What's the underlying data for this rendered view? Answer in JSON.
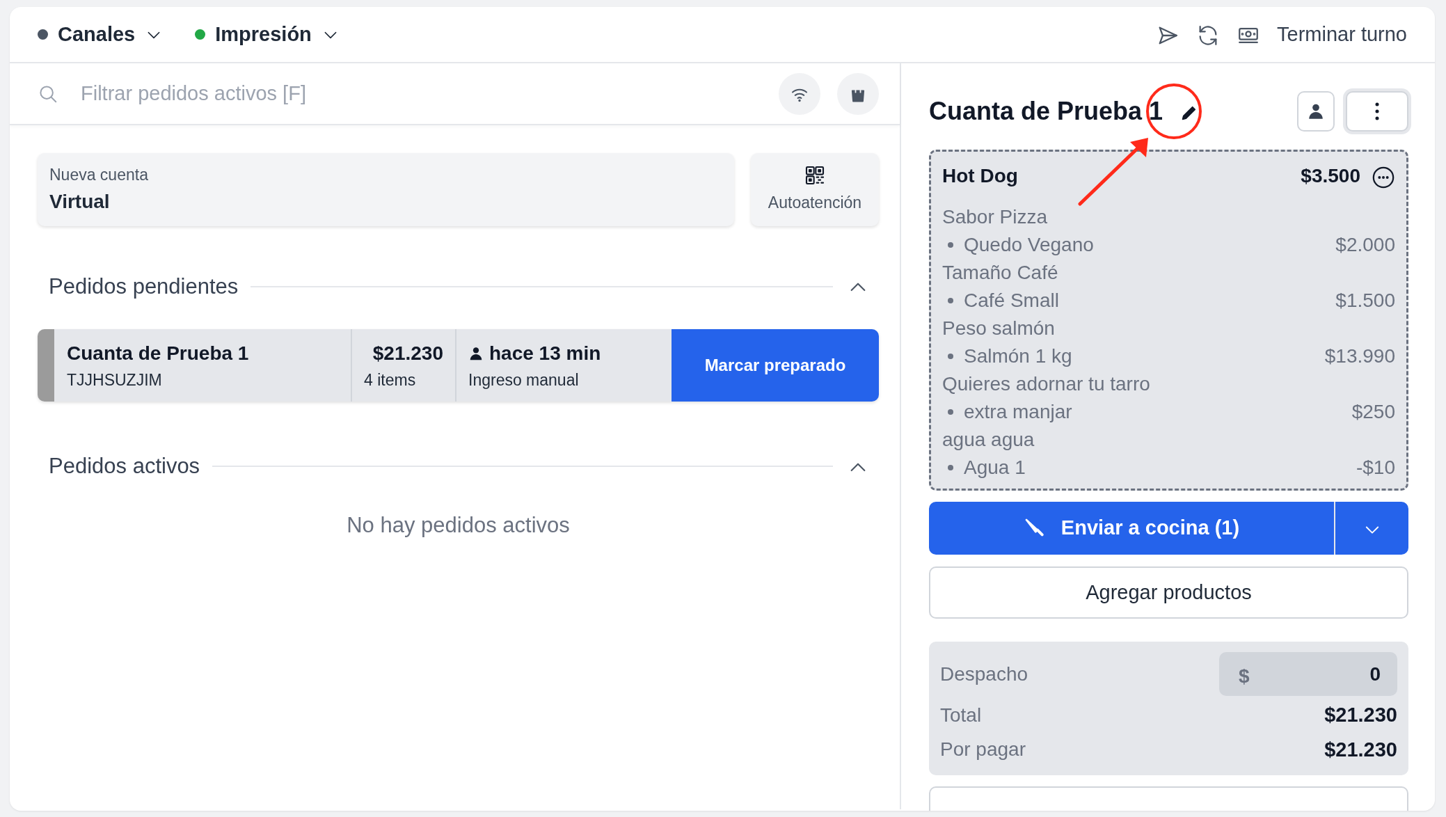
{
  "header": {
    "menus": [
      {
        "label": "Canales",
        "color": "#4b5563"
      },
      {
        "label": "Impresión",
        "color": "#22a846"
      }
    ],
    "actions": [
      {
        "kind": "send"
      },
      {
        "kind": "refresh"
      },
      {
        "kind": "cash"
      }
    ],
    "end_shift": "Terminar turno"
  },
  "search": {
    "placeholder": "Filtrar pedidos activos [F]"
  },
  "new_account": {
    "label": "Nueva cuenta",
    "value": "Virtual"
  },
  "self_service": "Autoatención",
  "sections": [
    {
      "title": "Pedidos pendientes",
      "expanded": true,
      "orders": [
        {
          "name": "Cuanta de Prueba 1",
          "code": "TJJHSUZJIM",
          "amount": "$21.230",
          "items": "4 items",
          "time": "hace 13 min",
          "source": "Ingreso manual",
          "action": "Marcar preparado"
        }
      ]
    },
    {
      "title": "Pedidos activos",
      "expanded": true,
      "empty_text": "No hay pedidos activos"
    }
  ],
  "account": {
    "title": "Cuanta de Prueba 1",
    "lines": [
      {
        "name": "Hot Dog",
        "price": "$3.500",
        "modifiers": [
          {
            "group": "Sabor Pizza",
            "option": "Quedo Vegano",
            "price": "$2.000"
          },
          {
            "group": "Tamaño Café",
            "option": "Café Small",
            "price": "$1.500"
          },
          {
            "group": "Peso salmón",
            "option": "Salmón 1 kg",
            "price": "$13.990"
          },
          {
            "group": "Quieres adornar tu tarro",
            "option": "extra manjar",
            "price": "$250"
          },
          {
            "group": "agua agua",
            "option": "Agua 1",
            "price": "-$10"
          }
        ]
      }
    ],
    "send_button": "Enviar a cocina (1)",
    "add_button": "Agregar productos",
    "summary": {
      "delivery_label": "Despacho",
      "currency": "$",
      "delivery_value": "0",
      "rows": [
        {
          "label": "Total",
          "value": "$21.230"
        },
        {
          "label": "Por pagar",
          "value": "$21.230"
        }
      ]
    }
  },
  "annotation": {
    "kind": "circle-with-arrow"
  }
}
